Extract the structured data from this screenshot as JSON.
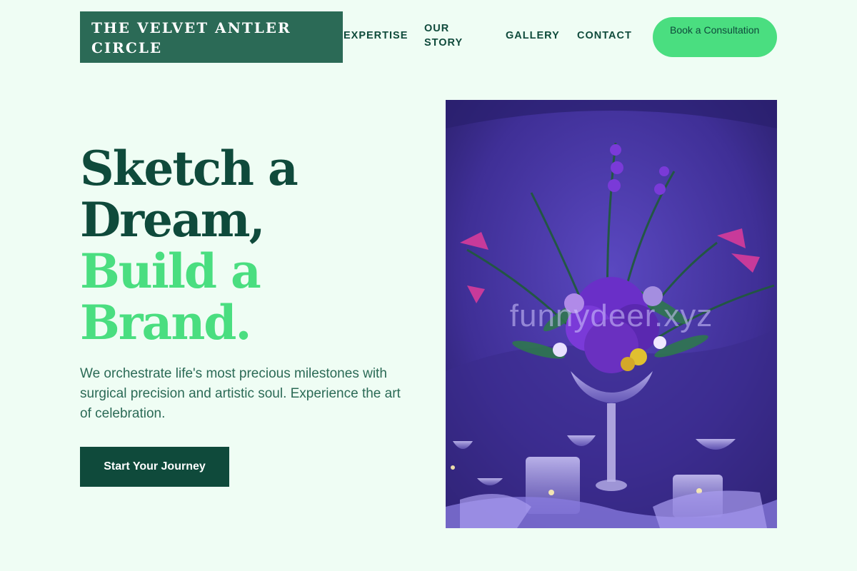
{
  "header": {
    "brand": "THE VELVET ANTLER CIRCLE",
    "nav": [
      {
        "label": "EXPERTISE"
      },
      {
        "label": "OUR STORY"
      },
      {
        "label": "GALLERY"
      },
      {
        "label": "CONTACT"
      }
    ],
    "cta_label": "Book a Consultation"
  },
  "hero": {
    "headline_dark": [
      "Sketch a",
      "Dream,"
    ],
    "headline_light": [
      "Build a",
      "Brand."
    ],
    "subtext": "We orchestrate life's most precious milestones with surgical precision and artistic soul. Experience the art of celebration.",
    "button_label": "Start Your Journey",
    "image": {
      "watermark": "funnydeer.xyz"
    }
  },
  "colors": {
    "background": "#effdf4",
    "brand_dark": "#0f4a3b",
    "brand_mid": "#2b6a56",
    "accent": "#4ade80",
    "image_purple": "#4c3aa0"
  },
  "icons": {
    "hero_image": "floral-centerpiece-photo"
  }
}
